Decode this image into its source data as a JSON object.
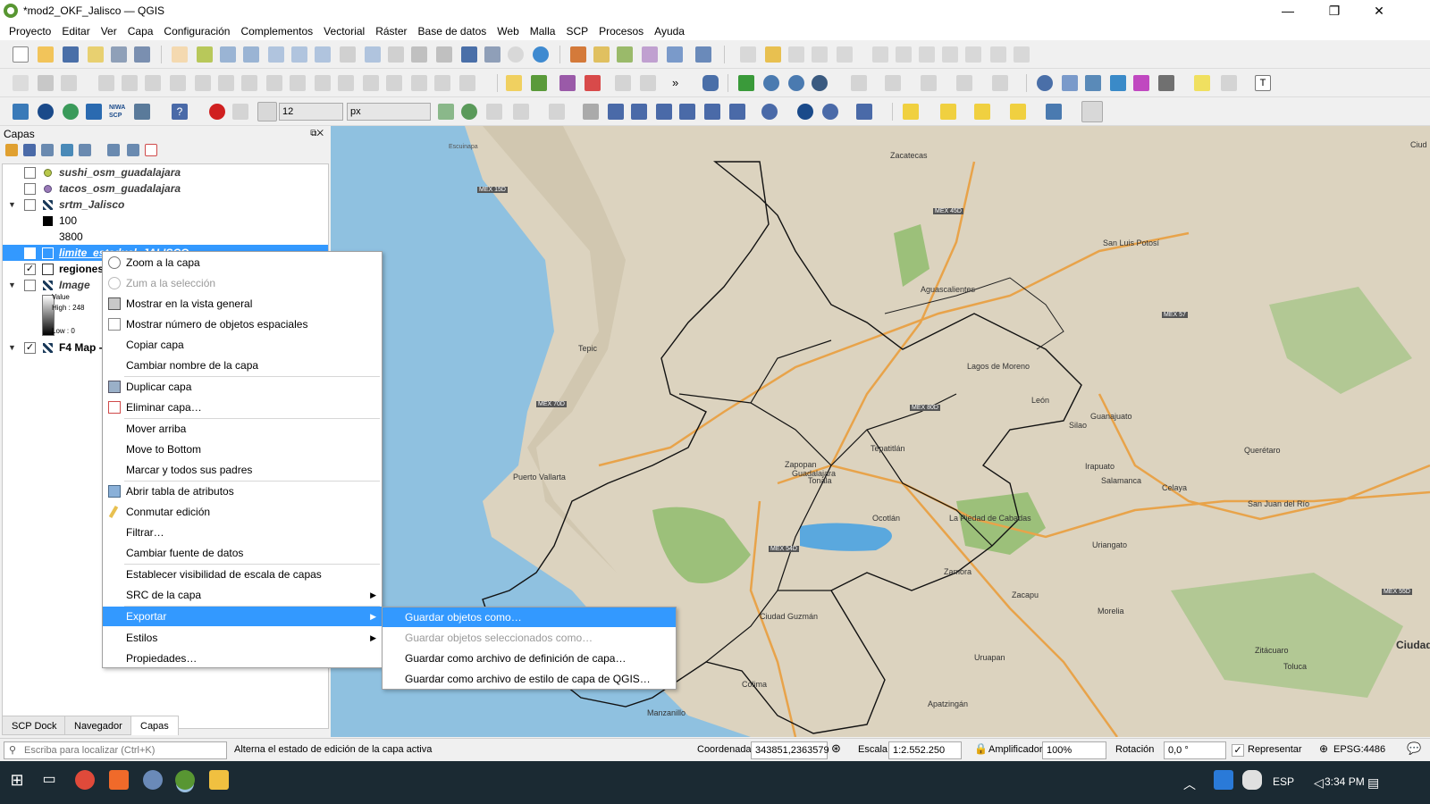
{
  "window": {
    "title": "*mod2_OKF_Jalisco — QGIS",
    "min": "—",
    "max": "❐",
    "close": "✕"
  },
  "menu": [
    "Proyecto",
    "Editar",
    "Ver",
    "Capa",
    "Configuración",
    "Complementos",
    "Vectorial",
    "Ráster",
    "Base de datos",
    "Web",
    "Malla",
    "SCP",
    "Procesos",
    "Ayuda"
  ],
  "toolbar3": {
    "size_value": "12",
    "unit_value": "px",
    "nina_scp": "NIWA SCP"
  },
  "panel": {
    "title": "Capas",
    "tabs": [
      "SCP Dock",
      "Navegador",
      "Capas"
    ]
  },
  "layers": [
    {
      "name": "sushi_osm_guadalajara",
      "checked": ""
    },
    {
      "name": "tacos_osm_guadalajara",
      "checked": ""
    },
    {
      "name": "srtm_Jalisco",
      "checked": ""
    },
    {
      "name": "limite_estadual_JALISCO",
      "checked": ""
    },
    {
      "name": "regiones",
      "checked": "✓"
    },
    {
      "name": "Image",
      "checked": ""
    },
    {
      "name": "F4 Map -",
      "checked": "✓"
    }
  ],
  "legend": {
    "srtm_low": "100",
    "srtm_high": "3800",
    "image_value": "Value",
    "image_high": "High : 248",
    "image_low": "Low : 0"
  },
  "context_menu": [
    "Zoom a la capa",
    "Zum a la selección",
    "Mostrar en la vista general",
    "Mostrar número de objetos espaciales",
    "Copiar capa",
    "Cambiar nombre de la capa",
    "Duplicar capa",
    "Eliminar capa…",
    "Mover arriba",
    "Move to Bottom",
    "Marcar y todos sus padres",
    "Abrir tabla de atributos",
    "Conmutar edición",
    "Filtrar…",
    "Cambiar fuente de datos",
    "Establecer visibilidad de escala de capas",
    "SRC de la capa",
    "Exportar",
    "Estilos",
    "Propiedades…"
  ],
  "submenu": [
    "Guardar objetos como…",
    "Guardar objetos seleccionados como…",
    "Guardar como archivo de definición de capa…",
    "Guardar como archivo de estilo de capa de QGIS…"
  ],
  "map_labels": [
    "Zacatecas",
    "San Luis Potosí",
    "Aguascalientes",
    "Tepic",
    "Lagos de Moreno",
    "León",
    "Guanajuato",
    "Silao",
    "Irapuato",
    "Salamanca",
    "Celaya",
    "Querétaro",
    "San Juan del Río",
    "Puerto Vallarta",
    "Tepatitlán",
    "Zapopan",
    "Guadalajara",
    "Tonala",
    "Ocotlán",
    "La Piedad de Cabadas",
    "Zamora",
    "Zacapu",
    "Uriangato",
    "Morelia",
    "Ciudad Guzmán",
    "Uruapan",
    "Colima",
    "Manzanillo",
    "Apatzingán",
    "Zitácuaro",
    "Toluca",
    "Ciudad",
    "Escuinapa",
    "MEX 15D",
    "MEX 45D",
    "MEX 57",
    "MEX 70D",
    "MEX 80D",
    "MEX 54D",
    "MEX 55D",
    "Ciud"
  ],
  "status": {
    "locator_placeholder": "Escriba para localizar (Ctrl+K)",
    "message": "Alterna el estado de edición de la capa activa",
    "coord_label": "Coordenada",
    "coord_value": "343851,2363579",
    "scale_label": "Escala",
    "scale_value": "1:2.552.250",
    "magnifier_label": "Amplificador",
    "magnifier_value": "100%",
    "rotation_label": "Rotación",
    "rotation_value": "0,0 °",
    "render_label": "Representar",
    "crs": "EPSG:4486"
  },
  "taskbar": {
    "lang": "ESP",
    "time": "3:34 PM"
  },
  "colors": {
    "selection": "#3399ff",
    "sea": "#8fc1e0",
    "land": "#dcd3bf"
  }
}
